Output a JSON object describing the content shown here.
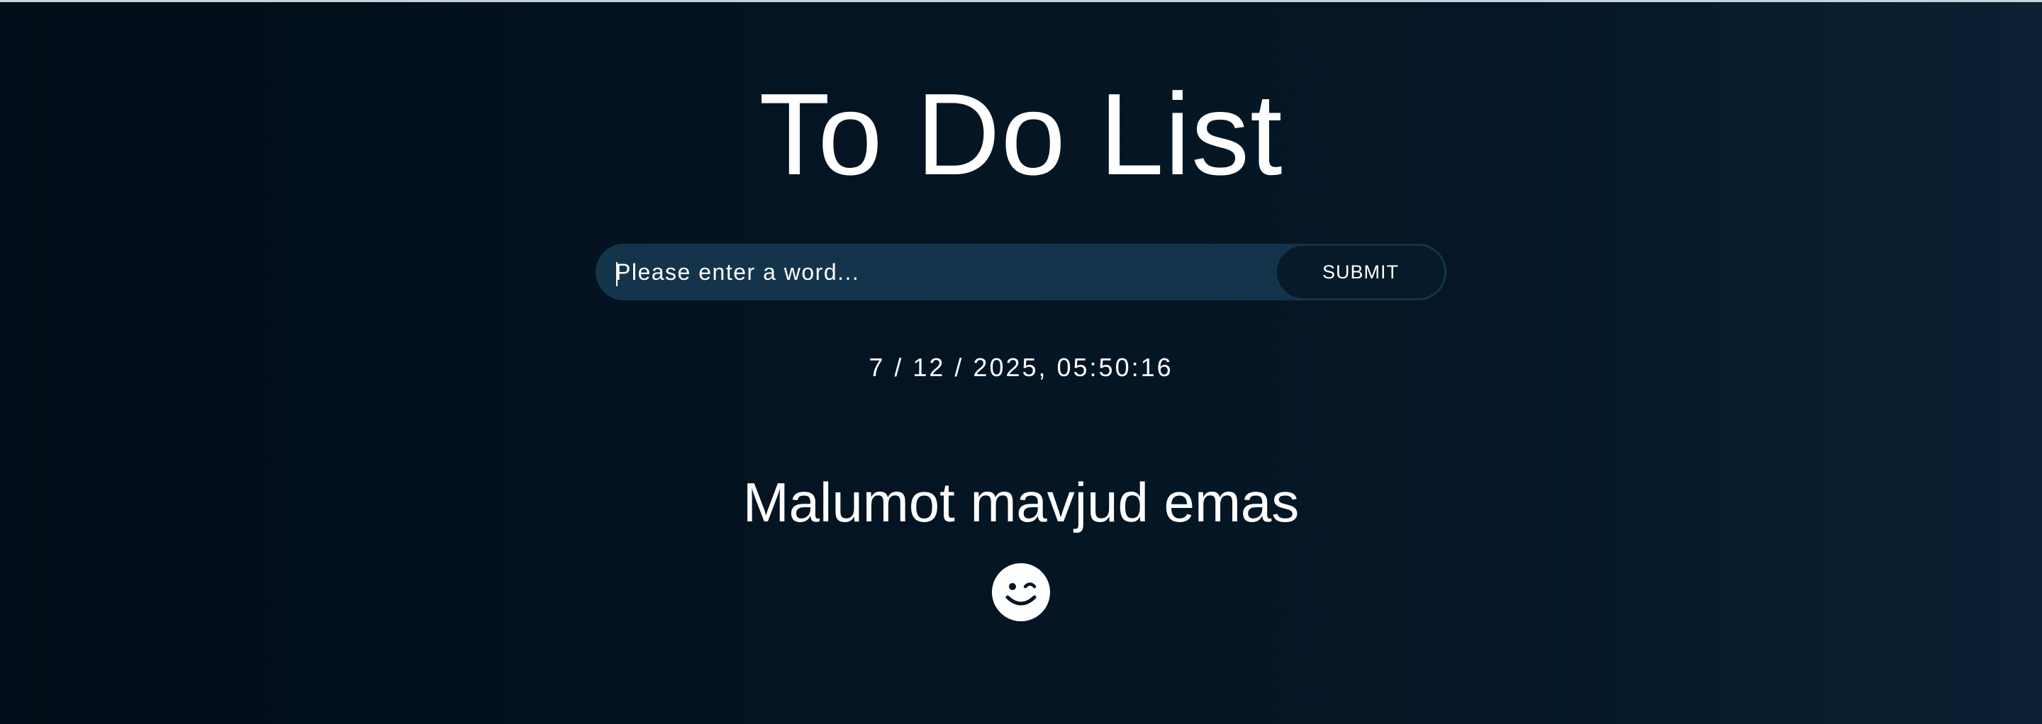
{
  "app": {
    "title": "To Do List"
  },
  "form": {
    "input_placeholder": "Please enter a word...",
    "input_value": "",
    "submit_label": "SUBMIT"
  },
  "clock": {
    "datetime": "7 / 12 / 2025, 05:50:16"
  },
  "empty_state": {
    "message": "Malumot mavjud emas",
    "icon": "wink-smiley-icon"
  },
  "colors": {
    "background_dark": "#010d18",
    "background_light": "#0b2133",
    "input_background": "#14344b",
    "button_background": "#071a29",
    "text": "#ffffff"
  }
}
